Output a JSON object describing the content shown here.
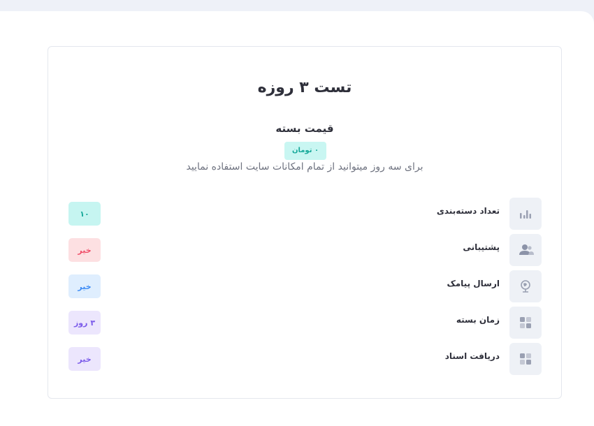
{
  "plan": {
    "title": "تست ۳ روزه",
    "price_title": "قیمت بسته",
    "price_badge": "۰ تومان",
    "description": "برای سه روز میتوانید از تمام امکانات سایت استفاده نمایید"
  },
  "features": [
    {
      "label": "تعداد دسته‌بندی",
      "value": "۱۰",
      "icon": "bar-chart-icon",
      "value_color": "#17a99a"
    },
    {
      "label": "پشتیبانی",
      "value": "خیر",
      "icon": "users-icon",
      "value_color": "#f0506a"
    },
    {
      "label": "ارسال پیامک",
      "value": "خیر",
      "icon": "globe-icon",
      "value_color": "#3e8cf5"
    },
    {
      "label": "زمان بسته",
      "value": "۳ روز",
      "icon": "grid-icon",
      "value_color": "#7b5bea"
    },
    {
      "label": "دریافت اسناد",
      "value": "خیر",
      "icon": "grid-icon",
      "value_color": "#7b5bea"
    }
  ]
}
